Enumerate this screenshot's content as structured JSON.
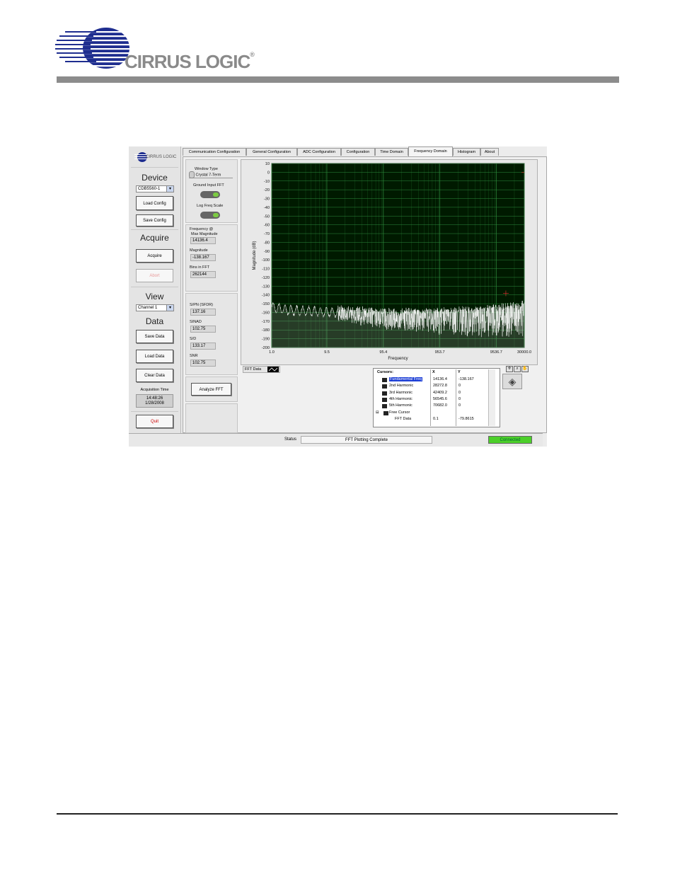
{
  "header": {
    "brand": "CIRRUS LOGIC",
    "registered_mark": "®"
  },
  "app": {
    "logo_text": "CIRRUS LOGIC",
    "left": {
      "device_title": "Device",
      "device_select": "CDB5560-1",
      "load_config": "Load Config",
      "save_config": "Save Config",
      "acquire_title": "Acquire",
      "acquire": "Acquire",
      "abort": "Abort",
      "view_title": "View",
      "channel_select": "Channel 1",
      "data_title": "Data",
      "save_data": "Save Data",
      "load_data": "Load Data",
      "clear_data": "Clear Data",
      "acq_time_label": "Acquisition Time",
      "acq_time": "14:48:26",
      "acq_date": "1/28/2008",
      "quit": "Quit"
    },
    "tabs": [
      "Communication Configuration",
      "General Configuration",
      "ADC Configuration",
      "Configuration",
      "Time Domain",
      "Frequency Domain",
      "Histogram",
      "About"
    ],
    "active_tab": "Frequency Domain",
    "controls": {
      "window_type_label": "Window Type",
      "window_type": "Crystal 7-Term",
      "ground_input_label": "Ground Input FFT",
      "log_freq_label": "Log Freq Scale",
      "freq_max_label_1": "Frequency @",
      "freq_max_label_2": "Max Magnitude",
      "freq_max": "14136.4",
      "magnitude_label": "Magnitude",
      "magnitude": "-138.167",
      "bins_label": "Bins in FFT",
      "bins": "262144",
      "sfdr_label": "S/PN (SFDR)",
      "sfdr": "137.16",
      "sinad_label": "SINAD",
      "sinad": "102.75",
      "sd_label": "S/D",
      "sd": "133.17",
      "snr_label": "SNR",
      "snr": "102.75",
      "analyze": "Analyze FFT"
    },
    "legend_label": "FFT Data",
    "cursors": {
      "headers": [
        "Cursors:",
        "X",
        "Y"
      ],
      "rows": [
        {
          "name": "Fundamental Freq",
          "x": "14136.4",
          "y": "-138.167"
        },
        {
          "name": "2nd Harmonic",
          "x": "28272.8",
          "y": "0"
        },
        {
          "name": "3rd Harmonic",
          "x": "42409.2",
          "y": "0"
        },
        {
          "name": "4th Harmonic",
          "x": "56545.6",
          "y": "0"
        },
        {
          "name": "5th Harmonic",
          "x": "70682.0",
          "y": "0"
        },
        {
          "name": "Free Cursor",
          "x": "",
          "y": ""
        },
        {
          "name": "FFT Data",
          "x": "0.1",
          "y": "-79.8615"
        }
      ]
    },
    "status": {
      "label": "Status",
      "text": "FFT Plotting Complete",
      "connection": "Connected"
    }
  },
  "chart_data": {
    "type": "line",
    "xlabel": "Frequency",
    "ylabel": "Magnitude (dB)",
    "x_scale": "log",
    "xlim": [
      1.0,
      30000.0
    ],
    "ylim": [
      -200,
      10
    ],
    "x_ticks": [
      "1.0",
      "9.5",
      "95.4",
      "953.7",
      "9536.7",
      "30000.0"
    ],
    "y_ticks": [
      "10",
      "0",
      "-10",
      "-20",
      "-30",
      "-40",
      "-50",
      "-60",
      "-70",
      "-80",
      "-90",
      "-100",
      "-110",
      "-120",
      "-130",
      "-140",
      "-150",
      "-160",
      "-170",
      "-180",
      "-190",
      "-200"
    ],
    "grid": true,
    "background": "#001a00",
    "grid_color": "#2d8c3c",
    "line_color": "#ffffff",
    "series": [
      {
        "x": [
          1,
          2,
          5,
          10,
          30,
          100,
          300,
          1000,
          3000,
          10000,
          14136.4,
          20000,
          30000
        ],
        "y": [
          -148,
          -152,
          -153,
          -154,
          -156,
          -158,
          -158,
          -157,
          -156,
          -153,
          -138.167,
          -150,
          -149
        ]
      }
    ]
  }
}
